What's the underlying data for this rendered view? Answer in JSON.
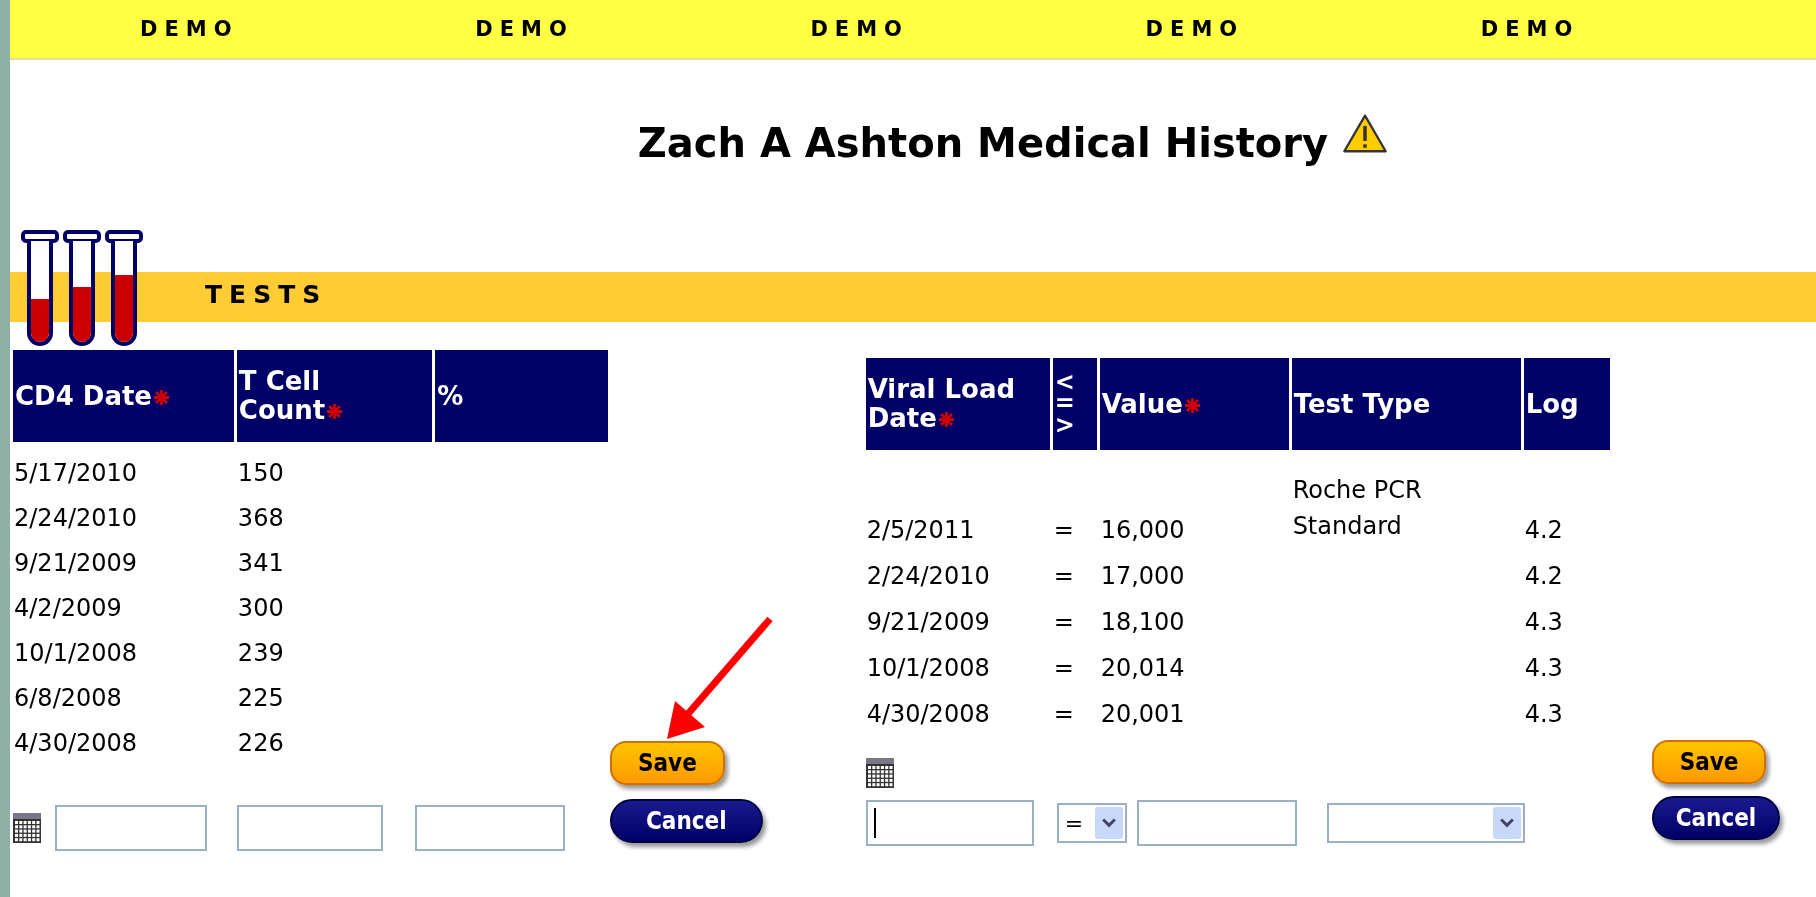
{
  "banner": [
    "DEMO",
    "DEMO",
    "DEMO",
    "DEMO",
    "DEMO"
  ],
  "title": "Zach A Ashton Medical History",
  "section": "TESTS",
  "cd4": {
    "columns": [
      {
        "label": "CD4 Date",
        "required": true
      },
      {
        "label": "T Cell Count",
        "required": true
      },
      {
        "label": "%",
        "required": false
      }
    ],
    "rows": [
      [
        "5/17/2010",
        "150",
        ""
      ],
      [
        "2/24/2010",
        "368",
        ""
      ],
      [
        "9/21/2009",
        "341",
        ""
      ],
      [
        "4/2/2009",
        "300",
        ""
      ],
      [
        "10/1/2008",
        "239",
        ""
      ],
      [
        "6/8/2008",
        "225",
        ""
      ],
      [
        "4/30/2008",
        "226",
        ""
      ]
    ],
    "save": "Save",
    "cancel": "Cancel"
  },
  "viral": {
    "columns": [
      {
        "label": "Viral Load Date",
        "required": true
      },
      {
        "label": "< = >",
        "required": false
      },
      {
        "label": "Value",
        "required": true
      },
      {
        "label": "Test Type",
        "required": false
      },
      {
        "label": "Log",
        "required": false
      }
    ],
    "rows": [
      [
        "2/5/2011",
        "=",
        "16,000",
        "Roche PCR Standard",
        "4.2"
      ],
      [
        "2/24/2010",
        "=",
        "17,000",
        "",
        "4.2"
      ],
      [
        "9/21/2009",
        "=",
        "18,100",
        "",
        "4.3"
      ],
      [
        "10/1/2008",
        "=",
        "20,014",
        "",
        "4.3"
      ],
      [
        "4/30/2008",
        "=",
        "20,001",
        "",
        "4.3"
      ]
    ],
    "operator": "=",
    "save": "Save",
    "cancel": "Cancel"
  }
}
